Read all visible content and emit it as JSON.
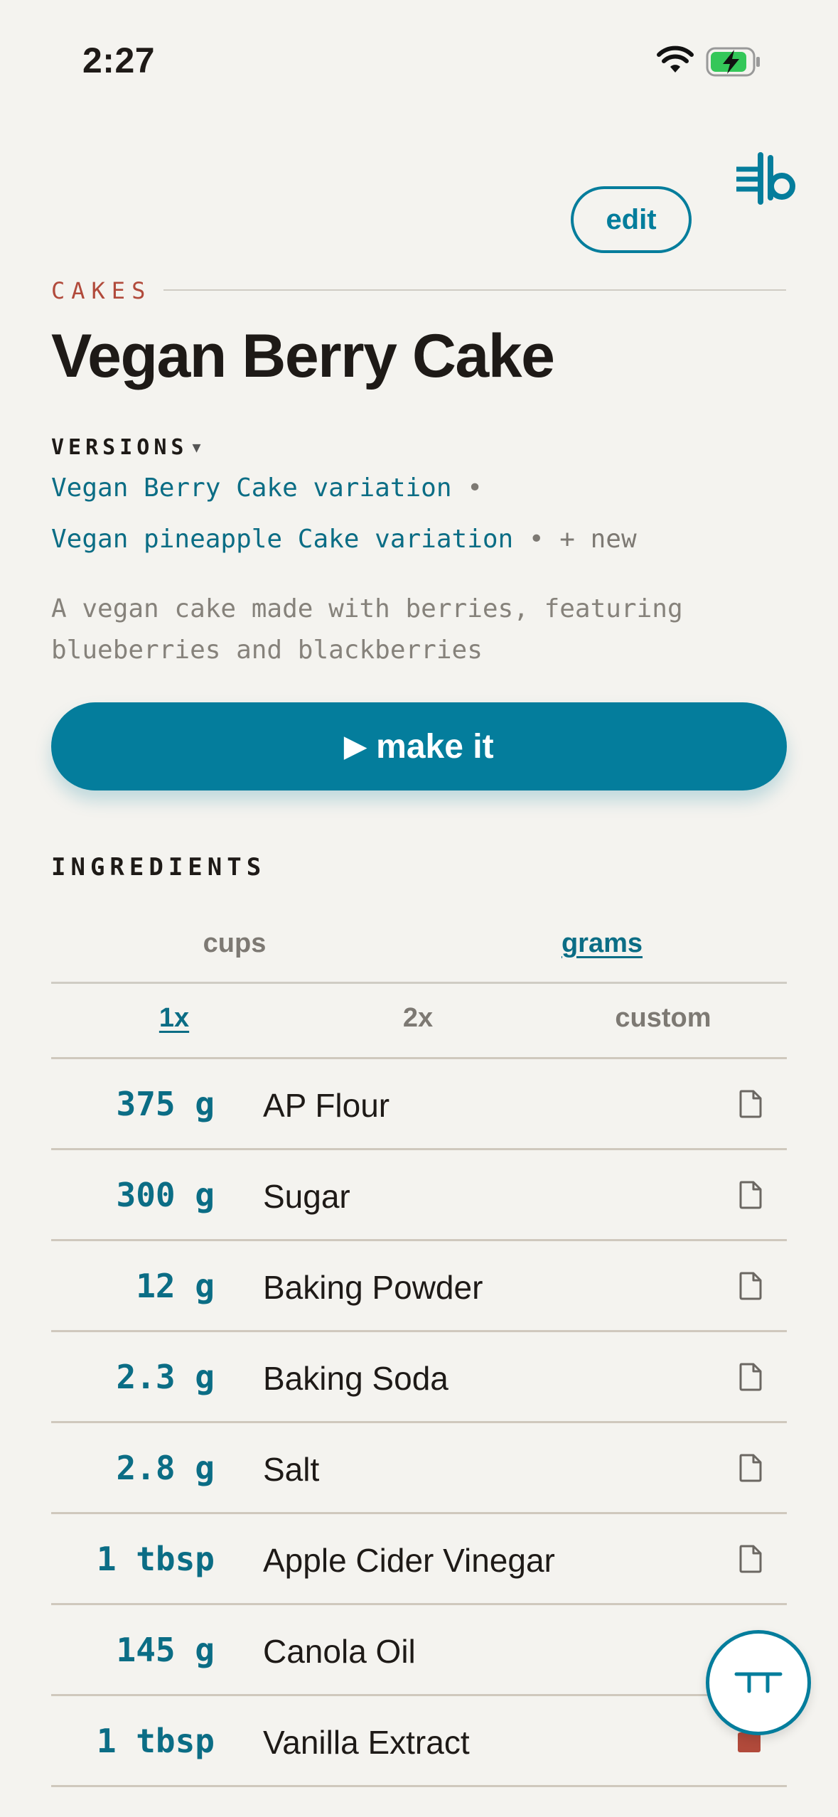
{
  "status_bar": {
    "time": "2:27"
  },
  "header": {
    "edit_label": "edit",
    "logo_text": "ǂb"
  },
  "recipe": {
    "category": "CAKES",
    "title": "Vegan Berry Cake",
    "versions_label": "VERSIONS",
    "versions_arrow": "▼",
    "versions": [
      "Vegan Berry Cake variation",
      "Vegan pineapple Cake variation"
    ],
    "separator": "•",
    "new_version_label": "+ new",
    "description": "A vegan cake made with berries, featuring blueberries and blackberries"
  },
  "make_it": {
    "icon": "▶",
    "label": "make it"
  },
  "ingredients": {
    "heading": "INGREDIENTS",
    "units": [
      "cups",
      "grams"
    ],
    "selected_unit": "grams",
    "multipliers": [
      "1x",
      "2x",
      "custom"
    ],
    "selected_multiplier": "1x",
    "items": [
      {
        "qty": "375 g",
        "name": "AP Flour"
      },
      {
        "qty": "300 g",
        "name": "Sugar"
      },
      {
        "qty": "12 g",
        "name": "Baking Powder"
      },
      {
        "qty": "2.3 g",
        "name": "Baking Soda"
      },
      {
        "qty": "2.8 g",
        "name": "Salt"
      },
      {
        "qty": "1 tbsp",
        "name": "Apple Cider Vinegar"
      },
      {
        "qty": "145 g",
        "name": "Canola Oil"
      },
      {
        "qty": "1 tbsp",
        "name": "Vanilla Extract"
      }
    ]
  },
  "icons": {
    "note": "document-icon",
    "fab": "timer-icon",
    "wifi": "wifi-icon",
    "battery": "battery-charging-icon"
  },
  "colors": {
    "accent": "#047d9c",
    "accent_text": "#0b6d85",
    "category": "#b14a3b",
    "background": "#f4f3ef"
  }
}
